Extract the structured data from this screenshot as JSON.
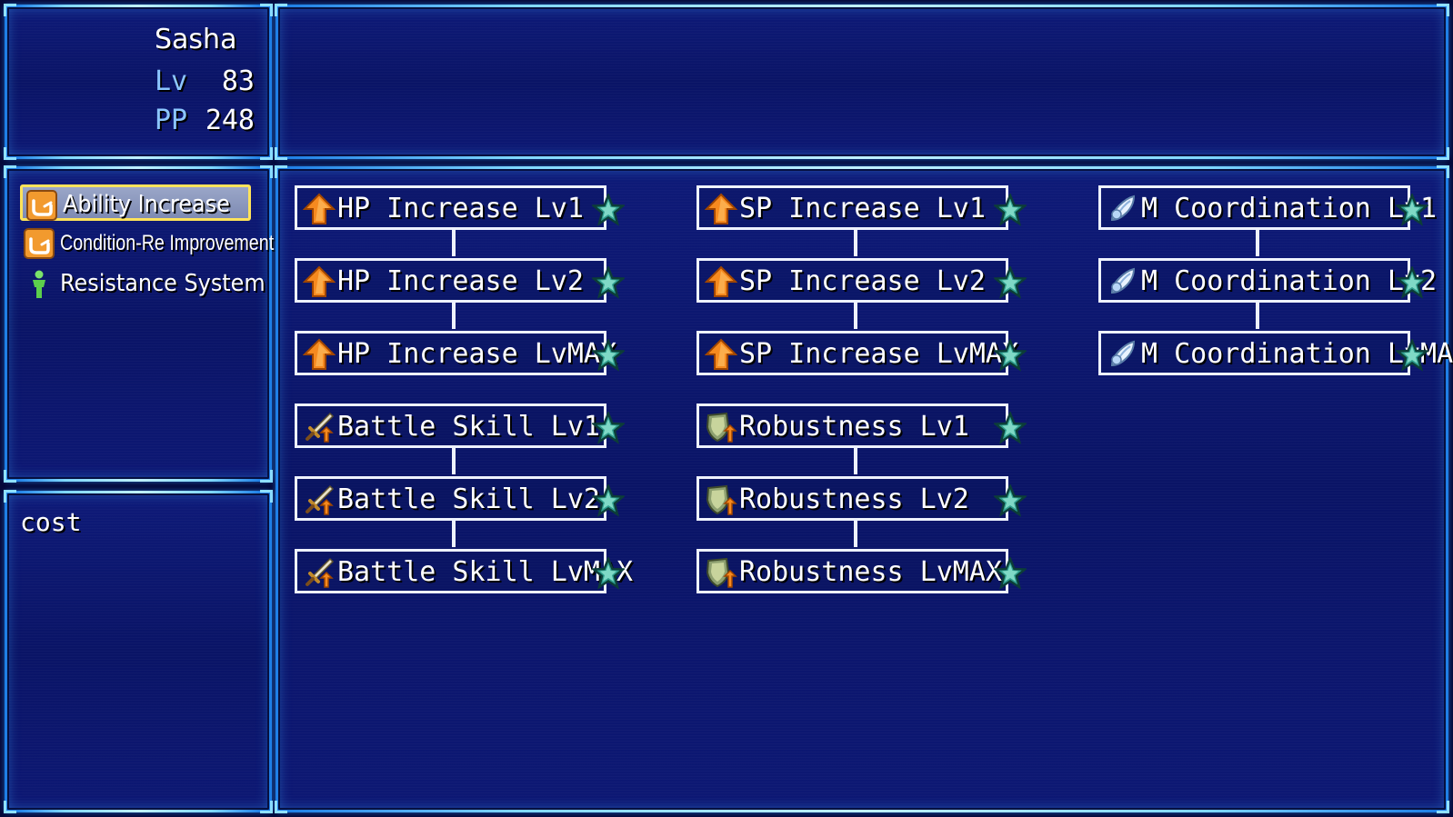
{
  "character": {
    "name": "Sasha",
    "lv_label": "Lv",
    "lv_value": "83",
    "pp_label": "PP",
    "pp_value": "248"
  },
  "categories": [
    {
      "label": "Ability Increase",
      "icon": "hand-icon",
      "selected": true
    },
    {
      "label": "Condition-Re Improvement",
      "icon": "hand-icon",
      "selected": false
    },
    {
      "label": "Resistance System",
      "icon": "person-icon",
      "selected": false
    }
  ],
  "cost": {
    "label": "cost"
  },
  "skill_tree": {
    "columns": [
      {
        "nodes": [
          {
            "label": "HP Increase Lv1",
            "icon": "up-arrow-icon"
          },
          {
            "label": "HP Increase Lv2",
            "icon": "up-arrow-icon"
          },
          {
            "label": "HP Increase LvMAX",
            "icon": "up-arrow-icon"
          },
          {
            "label": "Battle Skill Lv1",
            "icon": "sword-icon"
          },
          {
            "label": "Battle Skill Lv2",
            "icon": "sword-icon"
          },
          {
            "label": "Battle Skill LvMAX",
            "icon": "sword-icon"
          }
        ]
      },
      {
        "nodes": [
          {
            "label": "SP Increase Lv1",
            "icon": "up-arrow-icon"
          },
          {
            "label": "SP Increase Lv2",
            "icon": "up-arrow-icon"
          },
          {
            "label": "SP Increase LvMAX",
            "icon": "up-arrow-icon"
          },
          {
            "label": "Robustness Lv1",
            "icon": "shield-icon"
          },
          {
            "label": "Robustness Lv2",
            "icon": "shield-icon"
          },
          {
            "label": "Robustness LvMAX",
            "icon": "shield-icon"
          }
        ]
      },
      {
        "nodes": [
          {
            "label": "M Coordination Lv1",
            "icon": "wing-icon"
          },
          {
            "label": "M Coordination Lv2",
            "icon": "wing-icon"
          },
          {
            "label": "M Coordination LvMAX",
            "icon": "wing-icon"
          }
        ]
      }
    ]
  },
  "colors": {
    "frame": "#1f7fe6",
    "selection_border": "#ffe35a",
    "stat_label": "#8cc6ff"
  }
}
